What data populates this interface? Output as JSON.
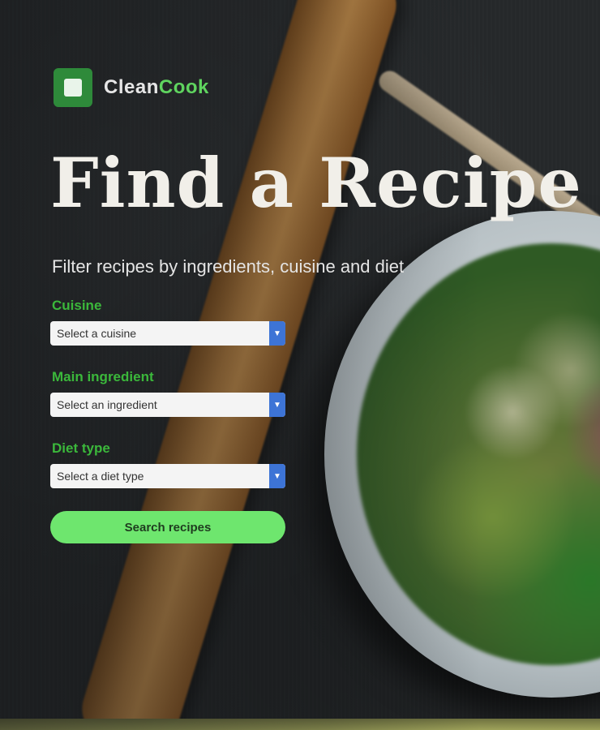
{
  "brand": {
    "name_part1": "Clean",
    "name_part2": "Cook",
    "logo_color": "#2e8a3a",
    "accent_green": "#5fd45f"
  },
  "hero": {
    "title": "Find a Recipe",
    "subtitle": "Filter recipes by ingredients, cuisine and diet"
  },
  "form": {
    "fields": [
      {
        "label": "Cuisine",
        "selected": "Select a cuisine"
      },
      {
        "label": "Main ingredient",
        "selected": "Select an ingredient"
      },
      {
        "label": "Diet type",
        "selected": "Select a diet type"
      }
    ],
    "submit_label": "Search recipes",
    "button_color": "#6ee66e",
    "select_arrow_color": "#3d74d6"
  },
  "icons": {
    "logo": "square-logo-icon",
    "dropdown": "chevron-down-icon"
  }
}
